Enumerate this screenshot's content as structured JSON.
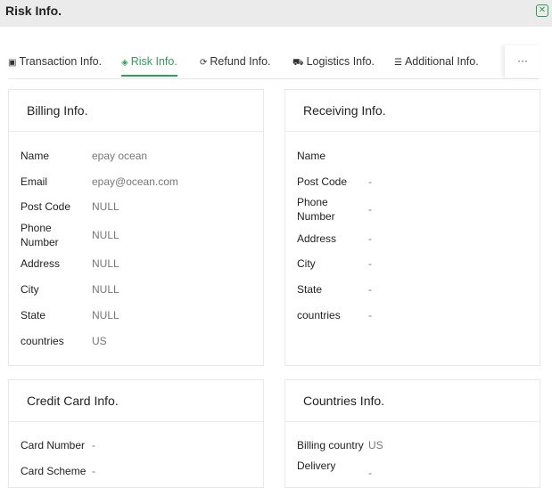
{
  "header": {
    "title": "Risk Info.",
    "close_icon": "close-icon"
  },
  "tabs": [
    {
      "label": "Transaction Info.",
      "icon": "▣"
    },
    {
      "label": "Risk Info.",
      "icon": "◈"
    },
    {
      "label": "Refund Info.",
      "icon": "⟳"
    },
    {
      "label": "Logistics Info.",
      "icon": "⛟"
    },
    {
      "label": "Additional Info.",
      "icon": "☰"
    }
  ],
  "tabs_more": "···",
  "accent_color": "#2f9e5b",
  "billing": {
    "title": "Billing Info.",
    "rows": [
      {
        "label": "Name",
        "value": "epay ocean"
      },
      {
        "label": "Email",
        "value": "epay@ocean.com"
      },
      {
        "label": "Post Code",
        "value": "NULL"
      },
      {
        "label": "Phone Number",
        "value": "NULL"
      },
      {
        "label": "Address",
        "value": "NULL"
      },
      {
        "label": "City",
        "value": "NULL"
      },
      {
        "label": "State",
        "value": "NULL"
      },
      {
        "label": "countries",
        "value": "US"
      }
    ]
  },
  "receiving": {
    "title": "Receiving Info.",
    "rows": [
      {
        "label": "Name",
        "value": ""
      },
      {
        "label": "Post Code",
        "value": "-"
      },
      {
        "label": "Phone Number",
        "value": "-"
      },
      {
        "label": "Address",
        "value": "-"
      },
      {
        "label": "City",
        "value": "-"
      },
      {
        "label": "State",
        "value": "-"
      },
      {
        "label": "countries",
        "value": "-"
      }
    ]
  },
  "credit_card": {
    "title": "Credit Card Info.",
    "rows": [
      {
        "label": "Card Number",
        "value": "-"
      },
      {
        "label": "Card Scheme",
        "value": "-"
      }
    ]
  },
  "countries": {
    "title": "Countries Info.",
    "rows": [
      {
        "label": "Billing country",
        "value": "US"
      },
      {
        "label": "Delivery",
        "value": "-"
      }
    ]
  }
}
